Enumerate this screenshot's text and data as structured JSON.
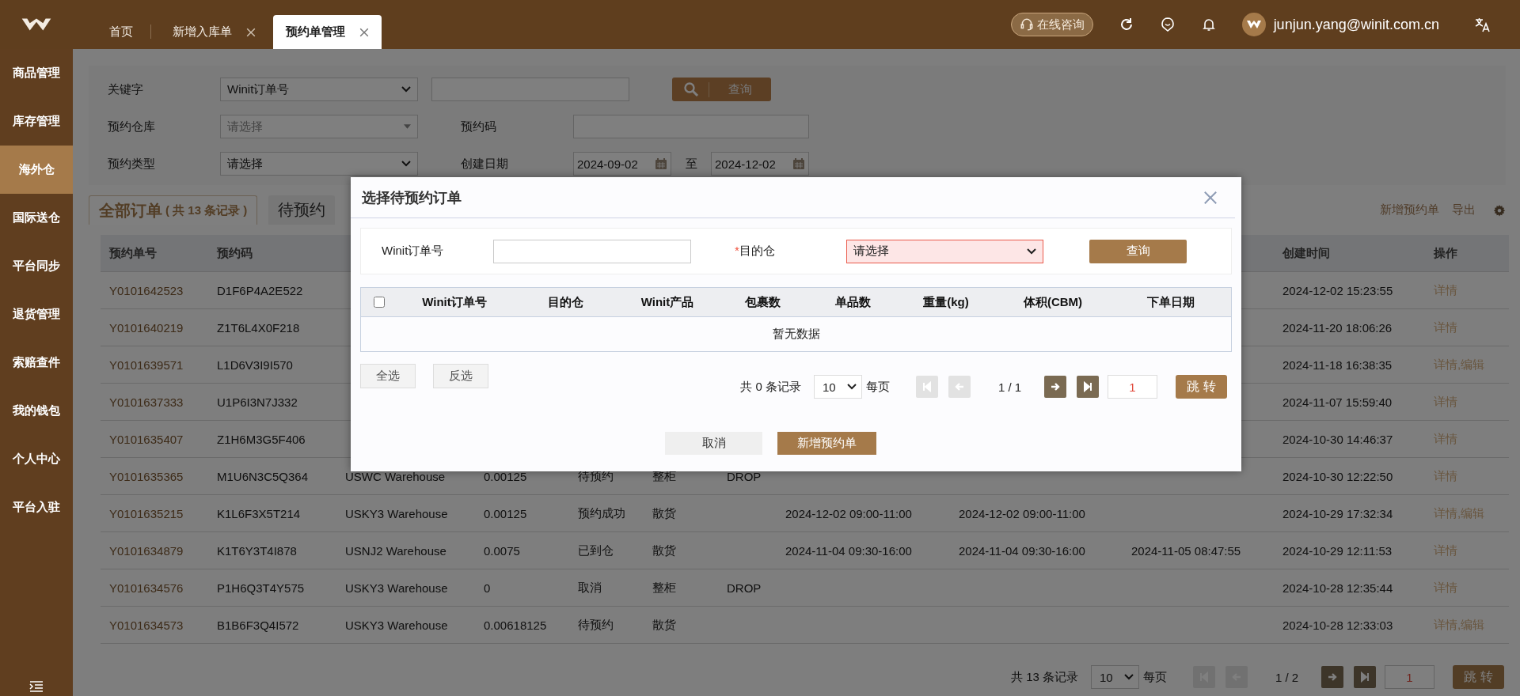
{
  "top_tabs": [
    {
      "label": "首页",
      "closable": false,
      "selected": false
    },
    {
      "label": "新增入库单",
      "closable": true,
      "selected": false
    },
    {
      "label": "预约单管理",
      "closable": true,
      "selected": true
    }
  ],
  "header": {
    "consult": "在线咨询",
    "user": "junjun.yang@winit.com.cn"
  },
  "sidebar": {
    "items": [
      {
        "label": "商品管理",
        "selected": false
      },
      {
        "label": "库存管理",
        "selected": false
      },
      {
        "label": "海外仓",
        "selected": true
      },
      {
        "label": "国际送仓",
        "selected": false
      },
      {
        "label": "平台同步",
        "selected": false
      },
      {
        "label": "退货管理",
        "selected": false
      },
      {
        "label": "索赔查件",
        "selected": false
      },
      {
        "label": "我的钱包",
        "selected": false
      },
      {
        "label": "个人中心",
        "selected": false
      },
      {
        "label": "平台入驻",
        "selected": false
      }
    ]
  },
  "filters": {
    "keyword_label": "关键字",
    "keyword_type": "Winit订单号",
    "search_button": "查询",
    "warehouse_label": "预约仓库",
    "warehouse_placeholder": "请选择",
    "code_label": "预约码",
    "type_label": "预约类型",
    "type_value": "请选择",
    "date_label": "创建日期",
    "date_from": "2024-09-02",
    "date_sep": "至",
    "date_to": "2024-12-02"
  },
  "order_tabs": [
    {
      "label": "全部订单",
      "count": "( 共 13 条记录 )",
      "selected": true
    },
    {
      "label": "待预约",
      "selected": false
    }
  ],
  "actions": [
    "新增预约单",
    "导出"
  ],
  "table": {
    "columns": {
      "order_no": "预约单号",
      "code": "预约码",
      "created": "创建时间",
      "actions": "操作"
    },
    "rows": [
      {
        "order_no": "Y0101642523",
        "code": "D1F6P4A2E522",
        "created": "2024-12-02 15:23:55",
        "actions": "详情"
      },
      {
        "order_no": "Y0101640219",
        "code": "Z1T6L4X0F218",
        "created": "2024-11-20 18:06:26",
        "actions": "详情"
      },
      {
        "order_no": "Y0101639571",
        "code": "L1D6V3I9I570",
        "created": "2024-11-18 16:38:35",
        "actions": "详情,编辑"
      },
      {
        "order_no": "Y0101637333",
        "code": "U1P6I3N7J332",
        "created": "2024-11-07 15:59:40",
        "actions": "详情"
      },
      {
        "order_no": "Y0101635407",
        "code": "Z1H6M3G5F406",
        "created": "2024-10-30 14:46:37",
        "actions": "详情"
      },
      {
        "order_no": "Y0101635365",
        "code": "M1U6N3C5Q364",
        "column_3": "USWC Warehouse",
        "column_4": "0.00125",
        "column_5": "待预约",
        "column_6": "整柜",
        "column_7": "DROP",
        "created": "2024-10-30 12:22:50",
        "actions": "详情"
      },
      {
        "order_no": "Y0101635215",
        "code": "K1L6F3X5T214",
        "column_3": "USKY3 Warehouse",
        "column_4": "0.00125",
        "column_5": "预约成功",
        "column_6": "散货",
        "column_8": "2024-12-02 09:00-11:00",
        "column_9": "2024-12-02 09:00-11:00",
        "created": "2024-10-29 17:32:34",
        "actions": "详情,编辑"
      },
      {
        "order_no": "Y0101634879",
        "code": "K1T6Y3T4I878",
        "column_3": "USNJ2 Warehouse",
        "column_4": "0.0075",
        "column_5": "已到仓",
        "column_6": "散货",
        "column_8": "2024-11-04 09:30-16:00",
        "column_9": "2024-11-04 09:30-16:00",
        "column_10": "2024-11-05 08:47:55",
        "created": "2024-10-29 12:11:53",
        "actions": "详情"
      },
      {
        "order_no": "Y0101634576",
        "code": "P1H6Q3T4Y575",
        "column_3": "USKY3 Warehouse",
        "column_4": "0",
        "column_5": "取消",
        "column_6": "整柜",
        "column_7": "DROP",
        "created": "2024-10-28 12:35:44",
        "actions": "详情"
      },
      {
        "order_no": "Y0101634573",
        "code": "B1B6F3Q4I572",
        "column_3": "USKY3 Warehouse",
        "column_4": "0.00618125",
        "column_5": "待预约",
        "column_6": "散货",
        "created": "2024-10-28 12:33:03",
        "actions": "详情,编辑"
      }
    ]
  },
  "pagination": {
    "total": "共 13 条记录",
    "page_size": "10",
    "per_page": "每页",
    "page": "1 / 2",
    "jump_value": "1",
    "jump_button": "跳 转",
    "nav": [
      {
        "kind": "first",
        "disabled": true
      },
      {
        "kind": "prev",
        "disabled": true
      },
      {
        "kind": "next",
        "disabled": false
      },
      {
        "kind": "last",
        "disabled": false
      }
    ]
  },
  "dialog": {
    "title": "选择待预约订单",
    "order_label": "Winit订单号",
    "required_mark": "*",
    "dest_label": "目的仓",
    "dest_placeholder": "请选择",
    "dest_invalid": true,
    "search_button": "查询",
    "select_all_checked": false,
    "columns": [
      "Winit订单号",
      "目的仓",
      "Winit产品",
      "包裹数",
      "单品数",
      "重量(kg)",
      "体积(CBM)",
      "下单日期"
    ],
    "empty_text": "暂无数据",
    "select_all": "全选",
    "invert": "反选",
    "pagination": {
      "total": "共 0 条记录",
      "page_size": "10",
      "per_page": "每页",
      "page": "1 / 1",
      "jump_value": "1",
      "jump_button": "跳 转",
      "nav": [
        {
          "kind": "first",
          "disabled": true
        },
        {
          "kind": "prev",
          "disabled": true
        },
        {
          "kind": "next",
          "disabled": false
        },
        {
          "kind": "last",
          "disabled": false
        }
      ]
    },
    "cancel": "取消",
    "confirm": "新增预约单"
  }
}
